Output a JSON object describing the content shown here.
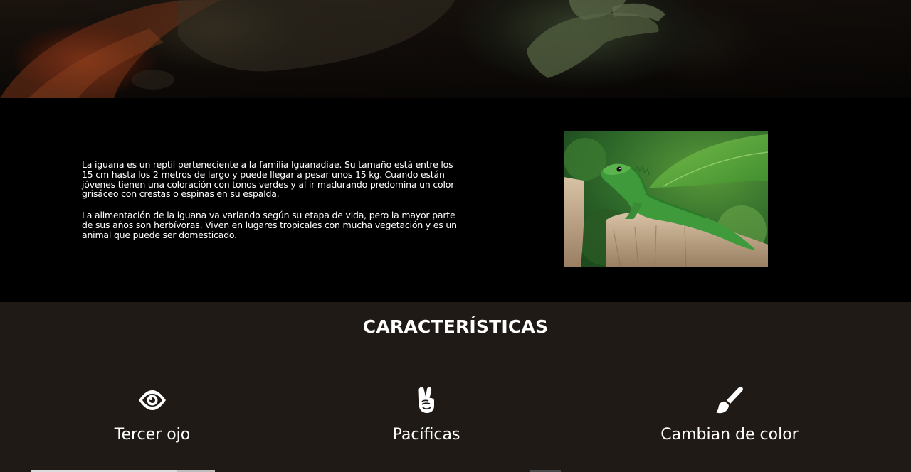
{
  "intro": {
    "paragraphs": [
      "La iguana es un reptil perteneciente a la familia Iguanadiae. Su tamaño está entre los 15 cm hasta los 2 metros de largo y puede llegar a pesar unos 15 kg. Cuando están jóvenes tienen una coloración con tonos verdes y al ir madurando predomina un color grisáceo con crestas o espinas en su espalda.",
      "La alimentación de la iguana va variando según su etapa de vida, pero la mayor parte de sus años son herbívoras. Viven en lugares tropicales con mucha vegetación y es un animal que puede ser domesticado."
    ]
  },
  "features": {
    "title": "CARACTERÍSTICAS",
    "items": [
      {
        "icon": "eye-icon",
        "label": "Tercer ojo"
      },
      {
        "icon": "peace-hand-icon",
        "label": "Pacíficas"
      },
      {
        "icon": "paint-brush-icon",
        "label": "Cambian de color"
      }
    ]
  },
  "colors": {
    "page_background": "#000000",
    "features_background": "#1f1a15",
    "text": "#ffffff"
  }
}
